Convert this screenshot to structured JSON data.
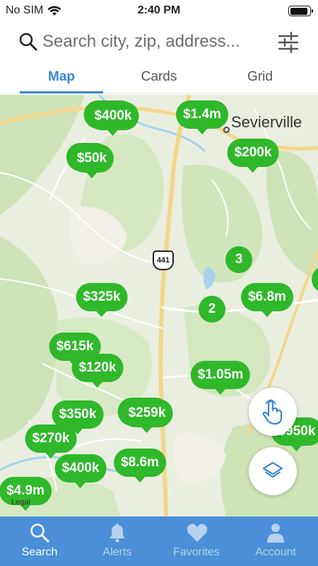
{
  "status": {
    "carrier": "No SIM",
    "time": "2:40 PM"
  },
  "search": {
    "placeholder": "Search city, zip, address..."
  },
  "tabs": [
    {
      "label": "Map",
      "active": true
    },
    {
      "label": "Cards",
      "active": false
    },
    {
      "label": "Grid",
      "active": false
    }
  ],
  "map": {
    "town": "Sevierville",
    "route_number": "441",
    "legal": "Legal",
    "pins": [
      "$400k",
      "$1.4m",
      "$200k",
      "$50k",
      "$325k",
      "$6.8m",
      "$615k",
      "$120k",
      "$1.05m",
      "$350k",
      "$259k",
      "$270k",
      "$400k",
      "$8.6m",
      "$4.9m",
      "$950k"
    ],
    "clusters": [
      "3",
      "2"
    ],
    "pin_color": "#2fb82a"
  },
  "nav": [
    {
      "label": "Search",
      "icon": "search-icon",
      "active": true
    },
    {
      "label": "Alerts",
      "icon": "bell-icon",
      "active": false
    },
    {
      "label": "Favorites",
      "icon": "heart-icon",
      "active": false
    },
    {
      "label": "Account",
      "icon": "person-icon",
      "active": false
    }
  ],
  "colors": {
    "accent": "#3a86d4",
    "nav_bg": "#4a8fd8"
  }
}
